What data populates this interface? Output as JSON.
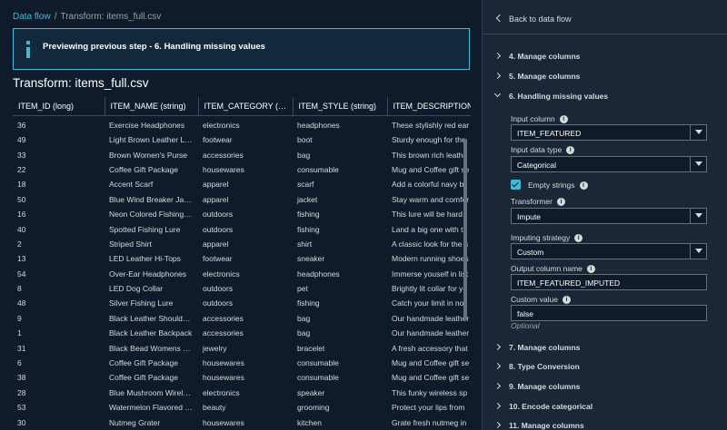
{
  "breadcrumb": {
    "link": "Data flow",
    "separator": "/",
    "current": "Transform: items_full.csv"
  },
  "info": {
    "message": "Previewing previous step - 6. Handling missing values"
  },
  "page_title": "Transform: items_full.csv",
  "table": {
    "columns": [
      "ITEM_ID (long)",
      "ITEM_NAME (string)",
      "ITEM_CATEGORY (str...",
      "ITEM_STYLE (string)",
      "ITEM_DESCRIPTION (..."
    ],
    "rows": [
      [
        "36",
        "Exercise Headphones",
        "electronics",
        "headphones",
        "These stylishly red ear"
      ],
      [
        "49",
        "Light Brown Leather La...",
        "footwear",
        "boot",
        "Sturdy enough for the"
      ],
      [
        "33",
        "Brown Women's Purse",
        "accessories",
        "bag",
        "This brown rich leathe"
      ],
      [
        "22",
        "Coffee Gift Package",
        "housewares",
        "consumable",
        "Mug and Coffee gift se"
      ],
      [
        "18",
        "Accent Scarf",
        "apparel",
        "scarf",
        "Add a colorful navy bl"
      ],
      [
        "50",
        "Blue Wind Breaker Jacket",
        "apparel",
        "jacket",
        "Stay warm and comfor"
      ],
      [
        "16",
        "Neon Colored Fishing L...",
        "outdoors",
        "fishing",
        "This lure will be hard t"
      ],
      [
        "40",
        "Spotted Fishing Lure",
        "outdoors",
        "fishing",
        "Land a big one with th"
      ],
      [
        "2",
        "Striped Shirt",
        "apparel",
        "shirt",
        "A classic look for the s"
      ],
      [
        "13",
        "LED Leather Hi-Tops",
        "footwear",
        "sneaker",
        "Modern running shoes"
      ],
      [
        "54",
        "Over-Ear Headphones",
        "electronics",
        "headphones",
        "Immerse youself in list"
      ],
      [
        "8",
        "LED Dog Collar",
        "outdoors",
        "pet",
        "Brightly lit collar for ye"
      ],
      [
        "48",
        "Silver Fishing Lure",
        "outdoors",
        "fishing",
        "Catch your limit in no"
      ],
      [
        "9",
        "Black Leather Shoulder ...",
        "accessories",
        "bag",
        "Our handmade leather"
      ],
      [
        "1",
        "Black Leather Backpack",
        "accessories",
        "bag",
        "Our handmade leather"
      ],
      [
        "31",
        "Black Bead Womens Br...",
        "jewelry",
        "bracelet",
        "A fresh accessory that"
      ],
      [
        "6",
        "Coffee Gift Package",
        "housewares",
        "consumable",
        "Mug and Coffee gift se"
      ],
      [
        "38",
        "Coffee Gift Package",
        "housewares",
        "consumable",
        "Mug and Coffee gift se"
      ],
      [
        "28",
        "Blue Mushroom Wireles...",
        "electronics",
        "speaker",
        "This funky wireless sp"
      ],
      [
        "53",
        "Watermelon Flavored Li...",
        "beauty",
        "grooming",
        "Protect your lips from"
      ],
      [
        "30",
        "Nutmeg Grater",
        "housewares",
        "kitchen",
        "Grate fresh nutmeg in"
      ]
    ]
  },
  "panel": {
    "back_label": "Back to data flow",
    "steps_before": [
      "4. Manage columns",
      "5. Manage columns"
    ],
    "active_step": "6. Handling missing values",
    "steps_after": [
      "7. Manage columns",
      "8. Type Conversion",
      "9. Manage columns",
      "10. Encode categorical",
      "11. Manage columns"
    ],
    "fields": {
      "input_column_label": "Input column",
      "input_column_value": "ITEM_FEATURED",
      "input_data_type_label": "Input data type",
      "input_data_type_value": "Categorical",
      "empty_strings_label": "Empty strings",
      "transformer_label": "Transformer",
      "transformer_value": "Impute",
      "imputing_strategy_label": "Imputing strategy",
      "imputing_strategy_value": "Custom",
      "output_column_label": "Output column name",
      "output_column_value": "ITEM_FEATURED_IMPUTED",
      "custom_value_label": "Custom value",
      "custom_value_value": "false",
      "optional_note": "Optional"
    }
  },
  "colors": {
    "accent": "#44b9d6",
    "background": "#0f1b2a",
    "panel": "#1b2636"
  }
}
